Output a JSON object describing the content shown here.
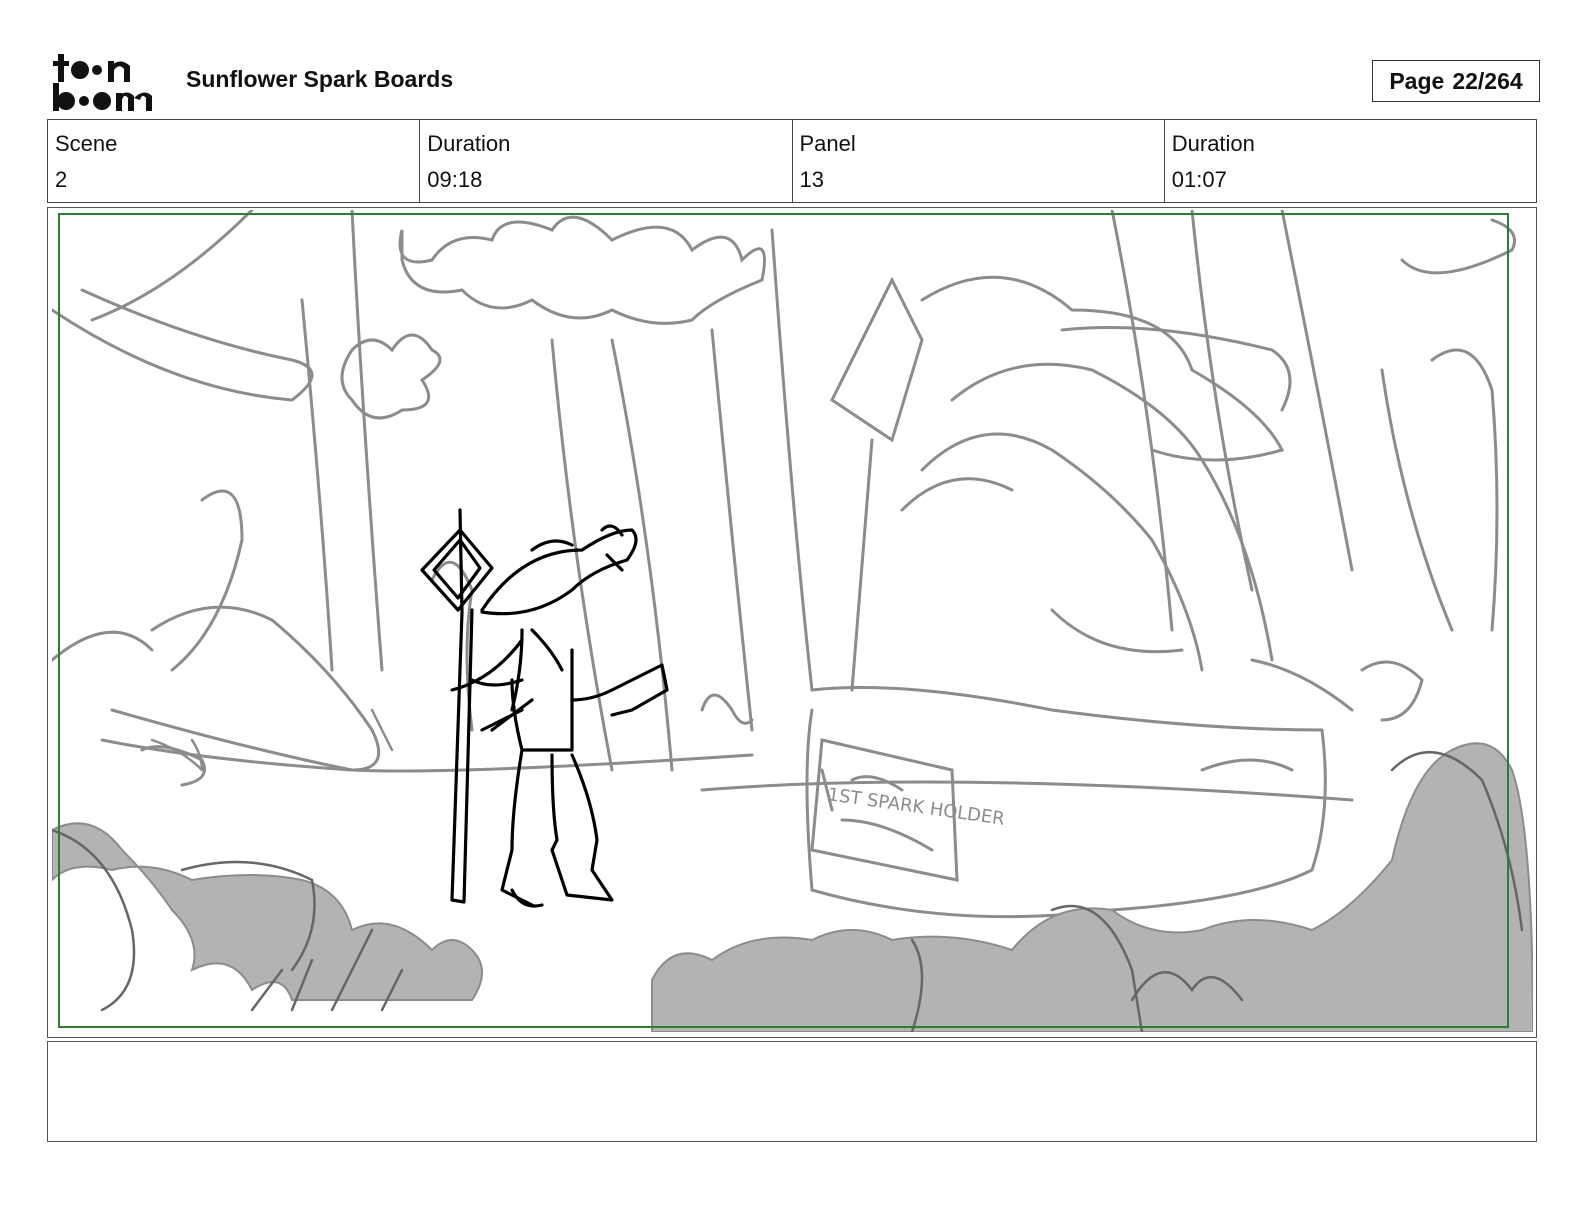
{
  "header": {
    "logo_text": "toon boom",
    "title": "Sunflower Spark Boards",
    "page_label": "Page",
    "page_number": "22/264"
  },
  "info": {
    "scene_label": "Scene",
    "scene_value": "2",
    "scene_duration_label": "Duration",
    "scene_duration_value": "09:18",
    "panel_label": "Panel",
    "panel_value": "13",
    "panel_duration_label": "Duration",
    "panel_duration_value": "01:07"
  },
  "panel": {
    "sign_text": "1ST SPARK HOLDER"
  },
  "notes": {
    "text": ""
  },
  "colors": {
    "safe_frame": "#2e7d32",
    "sketch_light": "#8c8c8c",
    "foliage_fill": "#b3b3b3",
    "ink": "#000000"
  }
}
